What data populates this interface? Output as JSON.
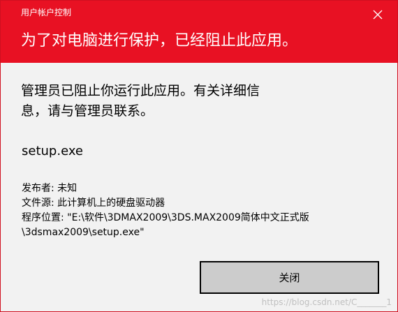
{
  "window": {
    "title": "用户帐户控制",
    "headline": "为了对电脑进行保护，已经阻止此应用。"
  },
  "message": {
    "line1": "管理员已阻止你运行此应用。有关详细信",
    "line2": "息，请与管理员联系。"
  },
  "program": {
    "name": "setup.exe"
  },
  "details": {
    "publisher": "发布者: 未知",
    "source": "文件源: 此计算机上的硬盘驱动器",
    "location_line1": "程序位置: \"E:\\软件\\3DMAX2009\\3DS.MAX2009简体中文正式版",
    "location_line2": "\\3dsmax2009\\setup.exe\""
  },
  "buttons": {
    "close_label": "关闭"
  },
  "watermark": "https://blog.csdn.net/C_______1",
  "colors": {
    "header_bg": "#e81123",
    "body_bg": "#f2f2f2",
    "button_bg": "#cccccc"
  },
  "icons": {
    "close": "close-icon"
  }
}
